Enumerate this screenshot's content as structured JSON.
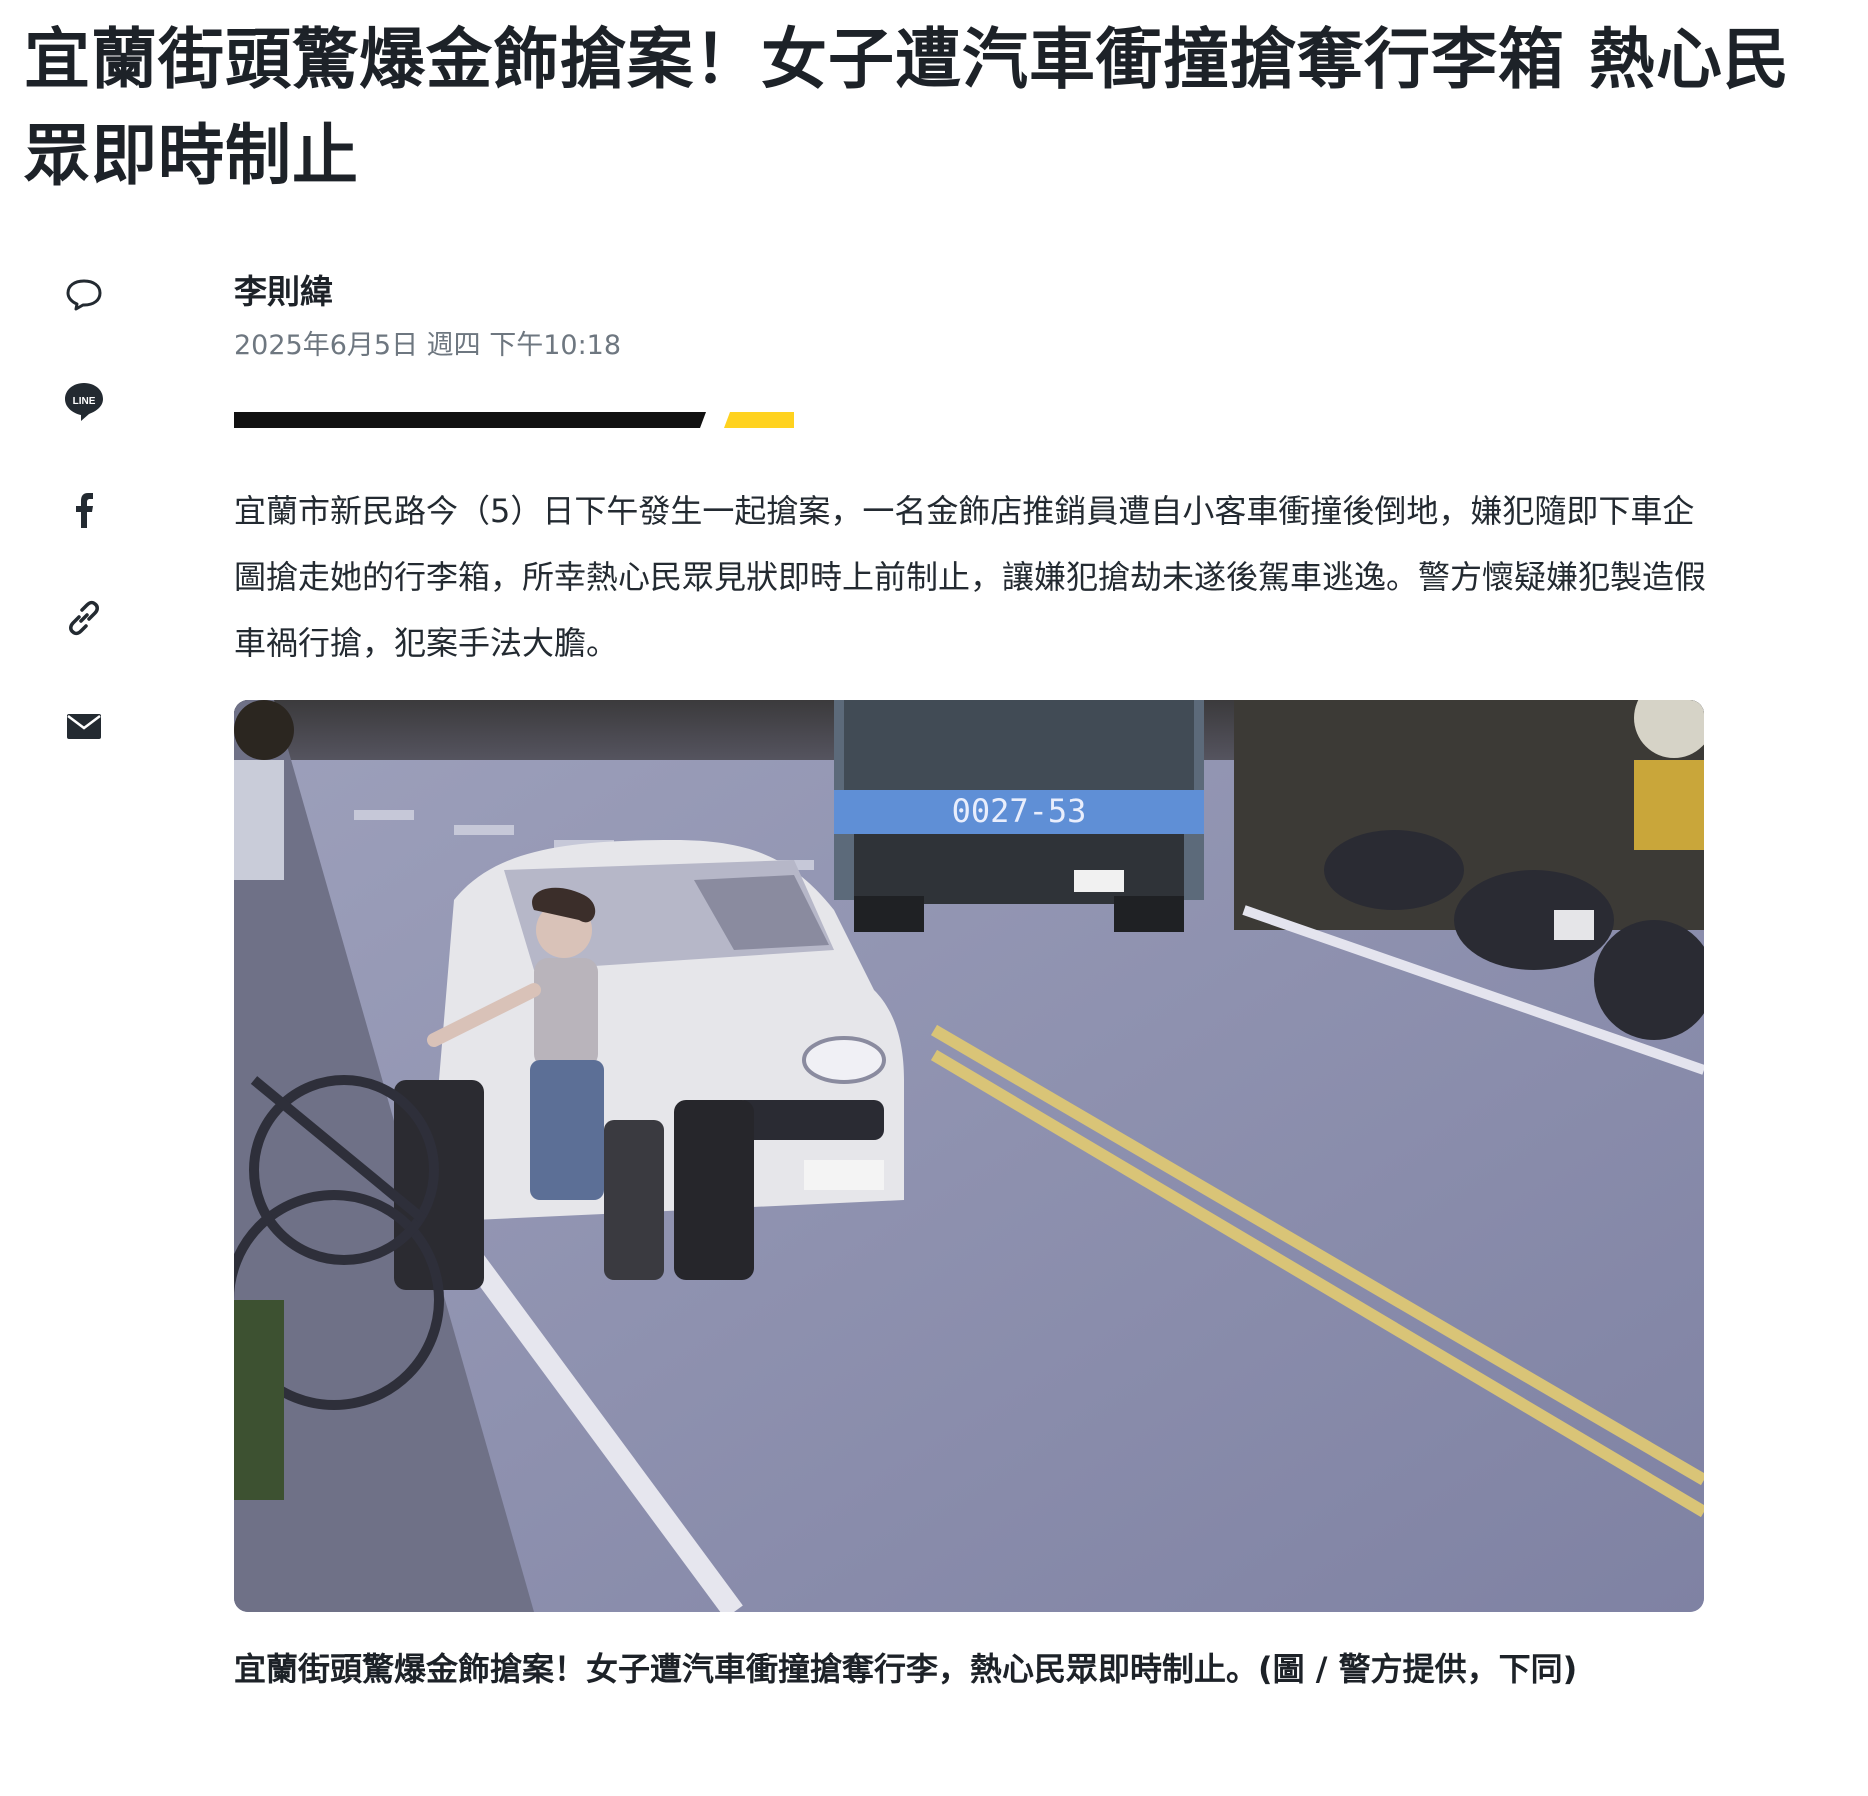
{
  "article": {
    "headline": "宜蘭街頭驚爆金飾搶案！女子遭汽車衝撞搶奪行李箱 熱心民眾即時制止",
    "author": "李則緯",
    "timestamp": "2025年6月5日 週四 下午10:18",
    "body": "宜蘭市新民路今（5）日下午發生一起搶案，一名金飾店推銷員遭自小客車衝撞後倒地，嫌犯隨即下車企圖搶走她的行李箱，所幸熱心民眾見狀即時上前制止，讓嫌犯搶劫未遂後駕車逃逸。警方懷疑嫌犯製造假車禍行搶，犯案手法大膽。",
    "image_caption": "宜蘭街頭驚爆金飾搶案！女子遭汽車衝撞搶奪行李，熱心民眾即時制止。(圖 / 警方提供，下同)",
    "truck_plate": "0027-53"
  },
  "share": {
    "line_label": "LINE",
    "icons": [
      "comment-icon",
      "line-icon",
      "facebook-icon",
      "link-icon",
      "mail-icon"
    ]
  },
  "colors": {
    "divider_black": "#111111",
    "divider_yellow": "#ffd21f",
    "text": "#232a31",
    "muted": "#6e7780"
  }
}
